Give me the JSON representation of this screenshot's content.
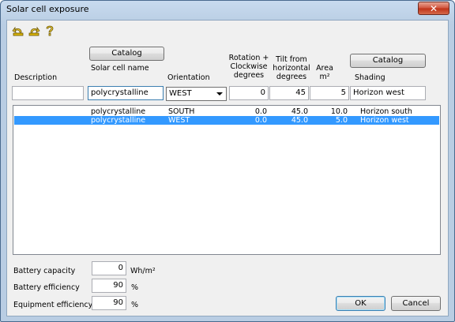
{
  "window": {
    "title": "Solar cell exposure",
    "close_glyph": "✕"
  },
  "toolbar": {
    "icons": [
      "undo-icon",
      "redo-icon",
      "help-icon"
    ]
  },
  "buttons": {
    "catalog_cell": "Catalog",
    "catalog_shading": "Catalog",
    "ok": "OK",
    "cancel": "Cancel"
  },
  "headers": {
    "description": "Description",
    "solar_cell_name": "Solar cell name",
    "orientation": "Orientation",
    "rotation_l1": "Rotation +",
    "rotation_l2": "Clockwise",
    "rotation_l3": "degrees",
    "tilt_l1": "Tilt from",
    "tilt_l2": "horizontal",
    "tilt_l3": "degrees",
    "area_l1": "Area",
    "area_l2": "m²",
    "shading": "Shading"
  },
  "editor": {
    "description": "",
    "solar_cell_name": "polycrystalline",
    "orientation": "WEST",
    "rotation": "0",
    "tilt": "45",
    "area": "5",
    "shading": "Horizon west"
  },
  "rows": [
    {
      "name": "polycrystalline",
      "orientation": "SOUTH",
      "rotation": "0.0",
      "tilt": "45.0",
      "area": "10.0",
      "shading": "Horizon south",
      "selected": false
    },
    {
      "name": "polycrystalline",
      "orientation": "WEST",
      "rotation": "0.0",
      "tilt": "45.0",
      "area": "5.0",
      "shading": "Horizon west",
      "selected": true
    }
  ],
  "bottom": {
    "battery_capacity_label": "Battery capacity",
    "battery_capacity_value": "0",
    "battery_capacity_unit": "Wh/m²",
    "battery_efficiency_label": "Battery efficiency",
    "battery_efficiency_value": "90",
    "battery_efficiency_unit": "%",
    "equipment_efficiency_label": "Equipment efficiency",
    "equipment_efficiency_value": "90",
    "equipment_efficiency_unit": "%"
  },
  "colors": {
    "selection": "#3399ff",
    "close": "#c7432a"
  }
}
